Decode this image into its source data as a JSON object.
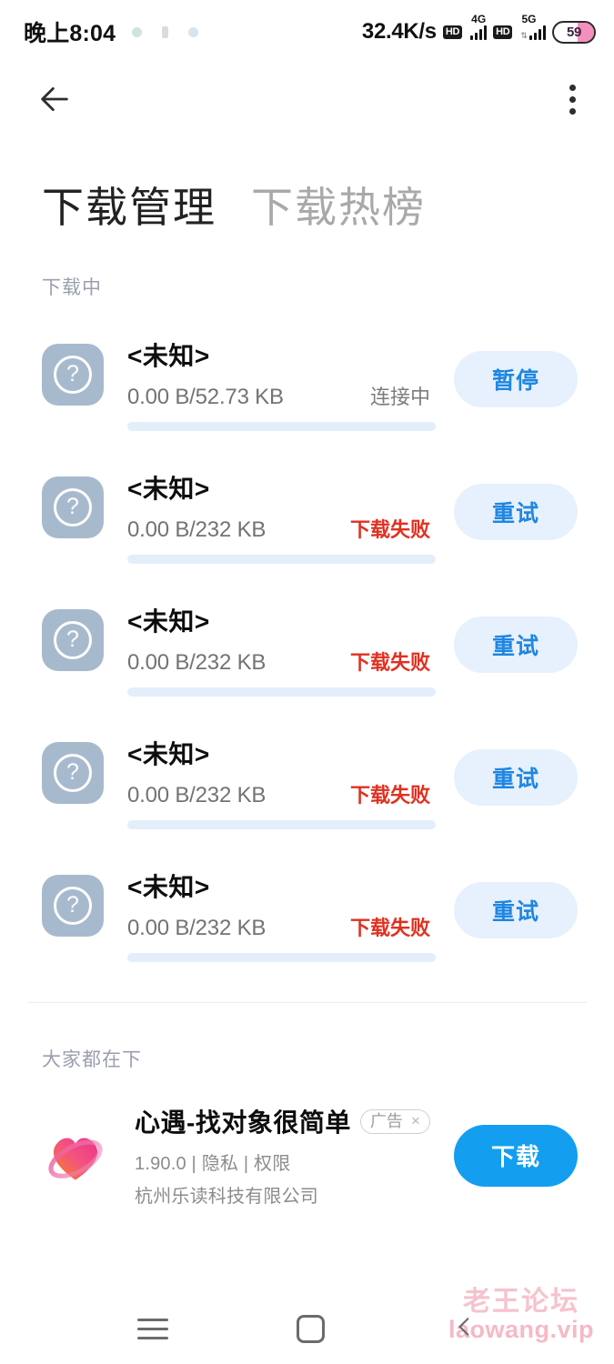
{
  "statusbar": {
    "time": "晚上8:04",
    "network_speed": "32.4K/s",
    "hd_badge_1": "HD",
    "net_label_1": "4G",
    "hd_badge_2": "HD",
    "net_label_2": "5G",
    "battery_level": "59"
  },
  "appbar": {
    "back_icon": "arrow-left-icon",
    "more_icon": "more-vertical-icon"
  },
  "tabs": [
    {
      "label": "下载管理",
      "active": true
    },
    {
      "label": "下载热榜",
      "active": false
    }
  ],
  "downloading": {
    "section_label": "下载中",
    "items": [
      {
        "name": "<未知>",
        "size": "0.00 B/52.73 KB",
        "status": "连接中",
        "status_type": "connecting",
        "progress_percent": 0,
        "action_label": "暂停",
        "icon": "unknown-app-icon",
        "icon_glyph": "?"
      },
      {
        "name": "<未知>",
        "size": "0.00 B/232 KB",
        "status": "下载失败",
        "status_type": "failed",
        "progress_percent": 0,
        "action_label": "重试",
        "icon": "unknown-app-icon",
        "icon_glyph": "?"
      },
      {
        "name": "<未知>",
        "size": "0.00 B/232 KB",
        "status": "下载失败",
        "status_type": "failed",
        "progress_percent": 0,
        "action_label": "重试",
        "icon": "unknown-app-icon",
        "icon_glyph": "?"
      },
      {
        "name": "<未知>",
        "size": "0.00 B/232 KB",
        "status": "下载失败",
        "status_type": "failed",
        "progress_percent": 0,
        "action_label": "重试",
        "icon": "unknown-app-icon",
        "icon_glyph": "?"
      },
      {
        "name": "<未知>",
        "size": "0.00 B/232 KB",
        "status": "下载失败",
        "status_type": "failed",
        "progress_percent": 0,
        "action_label": "重试",
        "icon": "unknown-app-icon",
        "icon_glyph": "?"
      }
    ]
  },
  "recommend": {
    "section_label": "大家都在下",
    "app": {
      "title": "心遇-找对象很简单",
      "ad_badge": "广告",
      "ad_close": "×",
      "subtitle": "1.90.0 | 隐私 | 权限",
      "developer": "杭州乐读科技有限公司",
      "download_label": "下载"
    }
  },
  "watermark": {
    "cn": "老王论坛",
    "en": "laowang.vip"
  },
  "navbar": {
    "recents_icon": "menu-icon",
    "home_icon": "square-home-icon",
    "back_icon": "chevron-left-icon"
  },
  "colors": {
    "accent_blue": "#139ef0",
    "action_blue_text": "#2086e0",
    "action_blue_bg": "#e6f1fd",
    "error_red": "#e03020",
    "muted": "#9a9fae",
    "battery_fill": "#f48fbe"
  }
}
